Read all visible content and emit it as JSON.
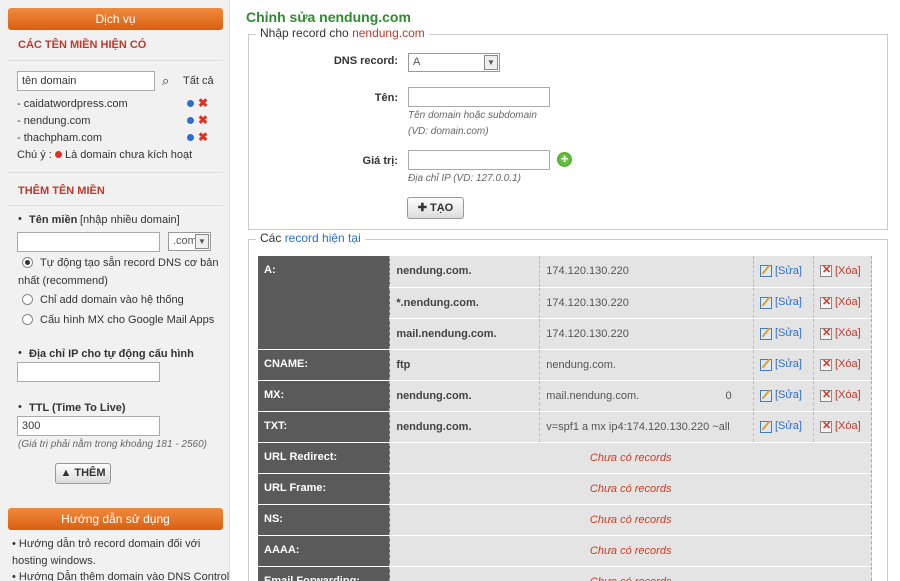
{
  "sidebar": {
    "header": "Dịch vụ",
    "existing_title": "CÁC TÊN MIỀN HIỆN CÓ",
    "search_placeholder": "tên domain",
    "search_value": "tên domain",
    "all_label": "Tất cả",
    "domains": [
      "- caidatwordpress.com",
      "- nendung.com",
      "- thachpham.com"
    ],
    "note_prefix": "Chú ý :",
    "note_text": "Là domain chưa kích hoạt",
    "add_title": "THÊM TÊN MIỀN",
    "domain_label": "Tên miền",
    "domain_hint": "[nhập nhiều domain]",
    "tld_value": ".com",
    "opt_auto": "Tự động tạo sẵn record DNS cơ bản",
    "opt_auto_2": "nhất (recommend)",
    "opt_only": "Chỉ add domain vào hệ thống",
    "opt_mx": "Cấu hình MX cho Google Mail Apps",
    "ip_label": "Địa chỉ IP cho tự động cấu hình",
    "ttl_label": "TTL (Time To Live)",
    "ttl_value": "300",
    "ttl_hint": "(Giá trị phải nằm trong khoảng 181 - 2560)",
    "add_button": "THÊM",
    "guide_header": "Hướng dẫn sử dụng",
    "guide_1a": "• Hướng dẫn trỏ record domain đối với",
    "guide_1b": "hosting windows.",
    "guide_2": "• Hướng Dẫn thêm domain vào DNS Control"
  },
  "main": {
    "title": "Chỉnh sửa nendung.com",
    "form_legend_prefix": "Nhập record cho ",
    "form_legend_domain": "nendung.com",
    "dns_record_label": "DNS record:",
    "dns_record_value": "A",
    "name_label": "Tên:",
    "name_hint_1": "Tên domain hoặc subdomain",
    "name_hint_2": "(VD: domain.com)",
    "value_label": "Giá trị:",
    "value_hint": "Địa chỉ IP (VD: 127.0.0.1)",
    "create_button": "TẠO",
    "records_legend_prefix": "Các ",
    "records_legend_highlight": "record hiện tại",
    "edit_label": "[Sửa]",
    "delete_label": "[Xóa]",
    "no_records": "Chưa có records",
    "records": [
      {
        "type": "A:",
        "name": "nendung.com.",
        "value": "174.120.130.220",
        "prio": ""
      },
      {
        "type": "",
        "name": "*.nendung.com.",
        "value": "174.120.130.220",
        "prio": ""
      },
      {
        "type": "",
        "name": "mail.nendung.com.",
        "value": "174.120.130.220",
        "prio": ""
      },
      {
        "type": "CNAME:",
        "name": "ftp",
        "value": "nendung.com.",
        "prio": ""
      },
      {
        "type": "MX:",
        "name": "nendung.com.",
        "value": "mail.nendung.com.",
        "prio": "0"
      },
      {
        "type": "TXT:",
        "name": "nendung.com.",
        "value": "v=spf1 a mx ip4:174.120.130.220 ~all",
        "prio": ""
      }
    ],
    "empty_types": [
      "URL Redirect:",
      "URL Frame:",
      "NS:",
      "AAAA:",
      "Email Forwarding:"
    ]
  }
}
